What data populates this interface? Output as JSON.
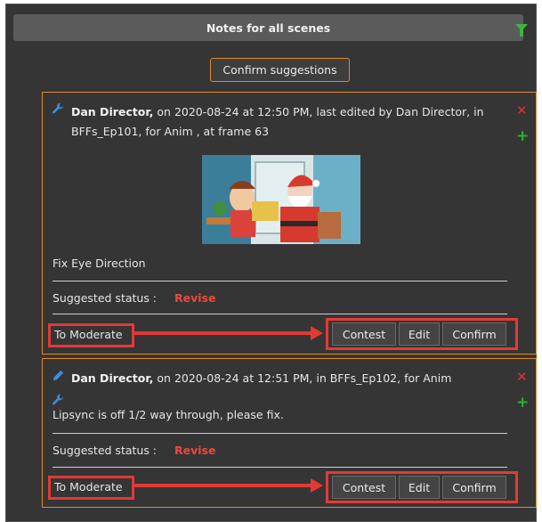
{
  "panel": {
    "title": "Notes for all scenes",
    "confirm_suggestions_label": "Confirm suggestions"
  },
  "notes": [
    {
      "author": "Dan Director,",
      "meta": " on 2020-08-24 at 12:50 PM, last edited by Dan Director, in",
      "meta2": "BFFs_Ep101, for Anim , at frame 63",
      "text": "Fix Eye Direction",
      "status_label": "Suggested status :",
      "status_value": "Revise",
      "moderate_label": "To Moderate",
      "buttons": [
        "Contest",
        "Edit",
        "Confirm"
      ]
    },
    {
      "author": "Dan Director,",
      "meta": " on 2020-08-24 at 12:51 PM, in BFFs_Ep102, for Anim",
      "text": "Lipsync is off 1/2 way through, please fix.",
      "status_label": "Suggested status :",
      "status_value": "Revise",
      "moderate_label": "To Moderate",
      "buttons": [
        "Contest",
        "Edit",
        "Confirm"
      ]
    }
  ],
  "icons": {
    "filter": "filter-icon",
    "wrench": "wrench-icon",
    "pencil": "pencil-icon",
    "delete": "close-icon",
    "add": "plus-icon"
  },
  "colors": {
    "background": "#353535",
    "header": "#5b5b5b",
    "accent_orange": "#e08a2b",
    "annotation_red": "#e53935",
    "status_red": "#e84a3d",
    "add_green": "#2fb12f"
  }
}
